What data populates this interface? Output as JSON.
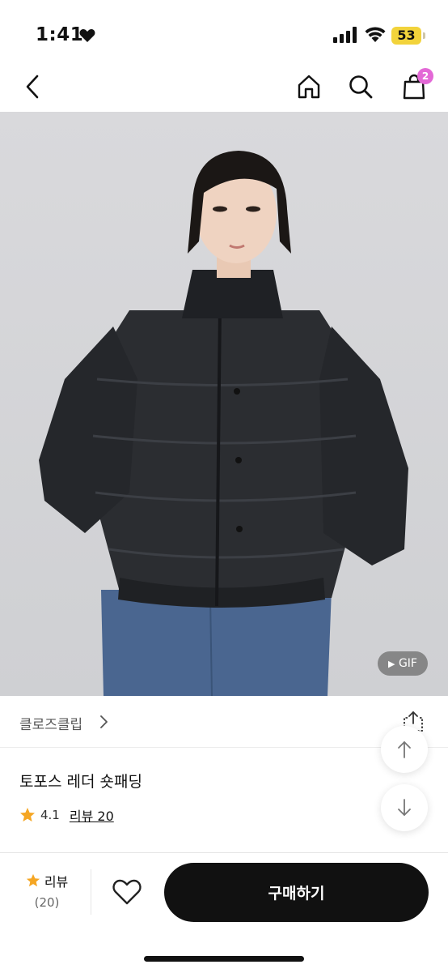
{
  "status": {
    "time": "1:41",
    "battery": "53"
  },
  "nav": {
    "cart_count": "2"
  },
  "hero": {
    "gif_label": "GIF"
  },
  "brand": {
    "name": "클로즈클립"
  },
  "product": {
    "title": "토포스 레더 숏패딩",
    "rating": "4.1",
    "review_link": "리뷰 20"
  },
  "bottom": {
    "review_label": "리뷰",
    "review_count": "(20)",
    "buy_label": "구매하기"
  },
  "colors": {
    "accent_star": "#f5a623",
    "badge": "#e368d6",
    "buy_button": "#111111",
    "battery": "#f2d33b"
  }
}
